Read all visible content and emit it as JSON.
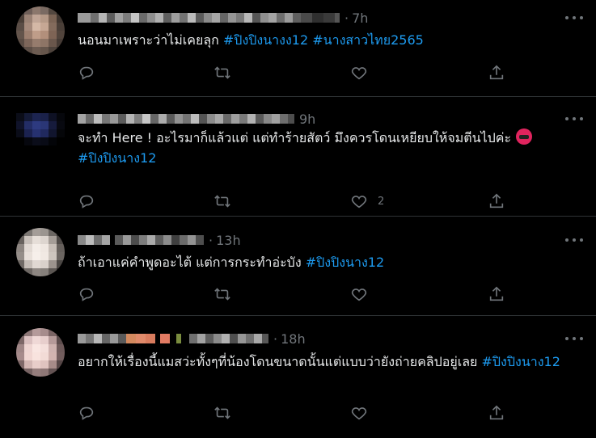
{
  "tweets": [
    {
      "time": "7h",
      "text_plain": "นอนมาเพราะว่าไม่เคยลุก ",
      "hashtag1": "#ปิงปิงนางง12",
      "hashtag2": "#นางสาวไทย2565",
      "likes": ""
    },
    {
      "time": "9h",
      "text_plain": "จะทำ Here ! อะไรมาก็แล้วแต่ แต่ทำร้ายสัตว์ มึงควรโดนเหยียบให้จมตีนไปค่ะ",
      "emoji_name": "angry-face-icon",
      "hashtag1": "#ปิงปิงนาง12",
      "likes": "2"
    },
    {
      "time": "13h",
      "text_plain": "ถ้าเอาแค่คำพูดอะไต้ แต่การกระทำอ่ะบัง ",
      "hashtag1": "#ปิงปิงนาง12",
      "likes": ""
    },
    {
      "time": "18h",
      "text_plain": "อยากให้เรื่องนี้แมสว่ะทั้งๆที่น้องโดนขนาดนั้นแต่แบบว่ายังถ่ายคลิปอยู่เลย ",
      "hashtag1": "#ปิงปิงนาง12",
      "likes": ""
    }
  ],
  "colors": {
    "background": "#000000",
    "text": "#e7e9ea",
    "muted": "#71767b",
    "hashtag": "#1d9bf0",
    "divider": "#2f3336"
  },
  "icons": [
    "reply-icon",
    "retweet-icon",
    "like-icon",
    "share-icon",
    "more-icon",
    "angry-face-icon"
  ]
}
